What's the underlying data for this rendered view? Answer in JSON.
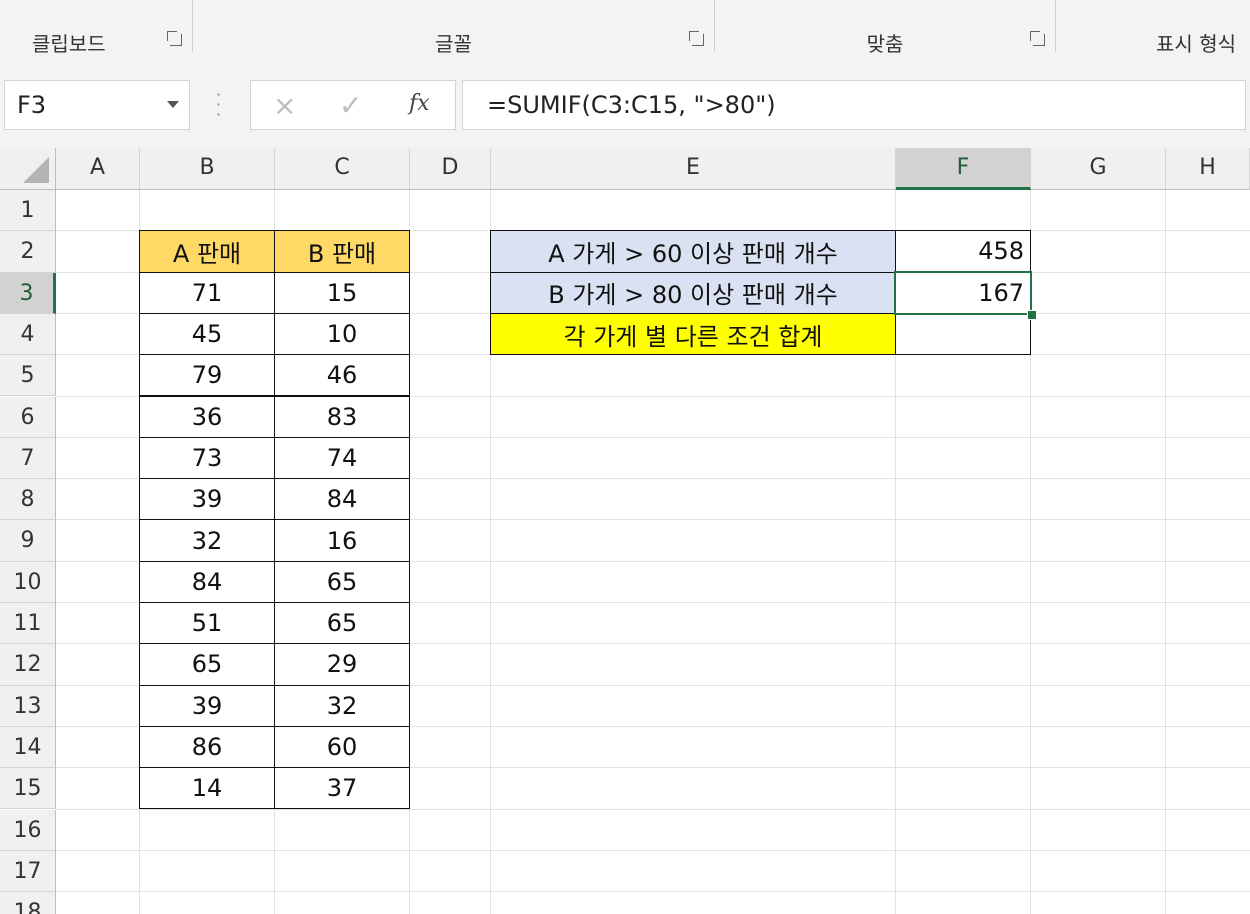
{
  "ribbon": {
    "groups": [
      {
        "label": "클립보드"
      },
      {
        "label": "글꼴"
      },
      {
        "label": "맞춤"
      },
      {
        "label": "표시 형식"
      }
    ]
  },
  "formula_bar": {
    "name_box": "F3",
    "cancel_icon": "×",
    "enter_icon": "✓",
    "fx_label": "fx",
    "formula": "=SUMIF(C3:C15, \">80\")"
  },
  "columns": [
    "A",
    "B",
    "C",
    "D",
    "E",
    "F",
    "G",
    "H"
  ],
  "rows": [
    "1",
    "2",
    "3",
    "4",
    "5",
    "6",
    "7",
    "8",
    "9",
    "10",
    "11",
    "12",
    "13",
    "14",
    "15",
    "16",
    "17",
    "18"
  ],
  "selected_cell": "F3",
  "sales_table": {
    "headers": [
      "A 판매",
      "B 판매"
    ],
    "rows": [
      [
        "71",
        "15"
      ],
      [
        "45",
        "10"
      ],
      [
        "79",
        "46"
      ],
      [
        "36",
        "83"
      ],
      [
        "73",
        "74"
      ],
      [
        "39",
        "84"
      ],
      [
        "32",
        "16"
      ],
      [
        "84",
        "65"
      ],
      [
        "51",
        "65"
      ],
      [
        "65",
        "29"
      ],
      [
        "39",
        "32"
      ],
      [
        "86",
        "60"
      ],
      [
        "14",
        "37"
      ]
    ]
  },
  "summary": {
    "rows": [
      {
        "label": "A 가게 > 60 이상 판매 개수",
        "value": "458"
      },
      {
        "label": "B 가게 > 80 이상 판매 개수",
        "value": "167"
      },
      {
        "label": "각 가게 별 다른 조건 합계",
        "value": ""
      }
    ]
  },
  "colors": {
    "header_orange": "#ffd966",
    "label_blue": "#d9e1f2",
    "label_yellow": "#ffff00",
    "selection_green": "#217346"
  }
}
